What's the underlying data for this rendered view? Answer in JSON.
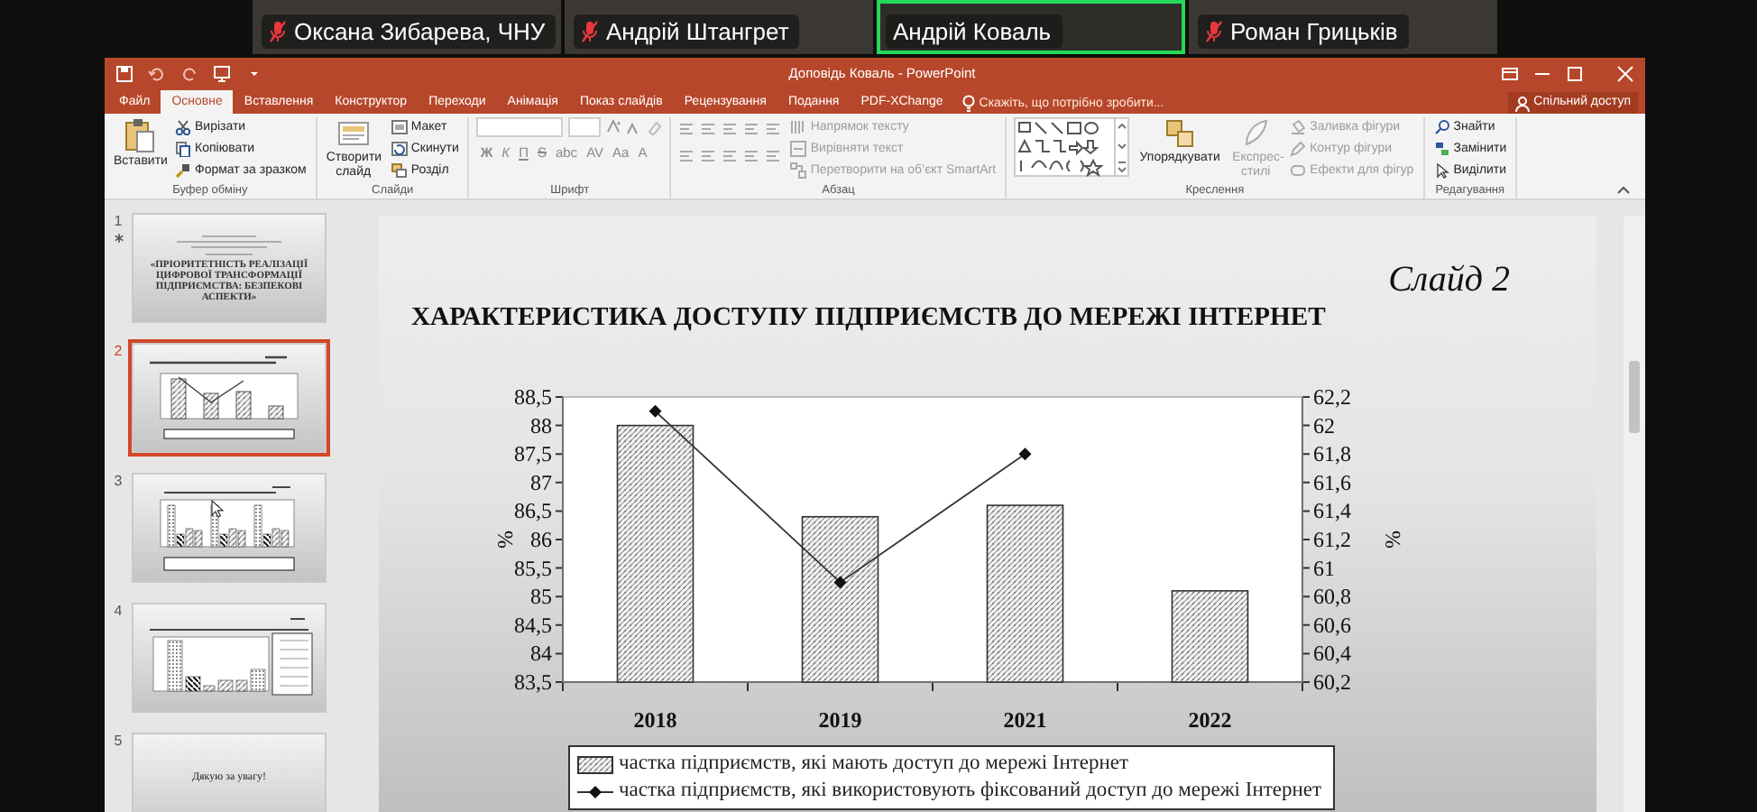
{
  "participants": [
    {
      "name": "Оксана Зибарева, ЧНУ",
      "muted": true,
      "speaking": false
    },
    {
      "name": "Андрій Штангрет",
      "muted": true,
      "speaking": false
    },
    {
      "name": "Андрій Коваль",
      "muted": false,
      "speaking": true
    },
    {
      "name": "Роман Грицьків",
      "muted": true,
      "speaking": false
    }
  ],
  "window": {
    "title": "Доповідь Коваль - PowerPoint"
  },
  "tabs": [
    {
      "label": "Файл",
      "selected": false
    },
    {
      "label": "Основне",
      "selected": true
    },
    {
      "label": "Вставлення",
      "selected": false
    },
    {
      "label": "Конструктор",
      "selected": false
    },
    {
      "label": "Переходи",
      "selected": false
    },
    {
      "label": "Анімація",
      "selected": false
    },
    {
      "label": "Показ слайдів",
      "selected": false
    },
    {
      "label": "Рецензування",
      "selected": false
    },
    {
      "label": "Подання",
      "selected": false
    },
    {
      "label": "PDF-XChange",
      "selected": false
    }
  ],
  "tell_me": {
    "placeholder": "Скажіть, що потрібно зробити..."
  },
  "share_button": "Спільний доступ",
  "ribbon": {
    "groups": [
      {
        "label": "Буфер обміну",
        "kind": "clipboard",
        "large": [
          {
            "label": "Вставити",
            "disabled": false
          }
        ],
        "small": [
          {
            "label": "Вирізати",
            "disabled": false
          },
          {
            "label": "Копіювати",
            "disabled": false
          },
          {
            "label": "Формат за зразком",
            "disabled": false
          }
        ]
      },
      {
        "label": "Слайди",
        "kind": "slides",
        "large": [
          {
            "label": "Створити слайд",
            "disabled": false
          }
        ],
        "small": [
          {
            "label": "Макет",
            "disabled": false
          },
          {
            "label": "Скинути",
            "disabled": false
          },
          {
            "label": "Розділ",
            "disabled": false
          }
        ]
      },
      {
        "label": "Шрифт",
        "kind": "font",
        "buttons": [
          "Ж",
          "К",
          "П",
          "S",
          "abc",
          "AV",
          "Aa",
          "A"
        ]
      },
      {
        "label": "Абзац",
        "kind": "paragraph",
        "small": [
          {
            "label": "Напрямок тексту",
            "disabled": true
          },
          {
            "label": "Вирівняти текст",
            "disabled": true
          },
          {
            "label": "Перетворити на об’єкт SmartArt",
            "disabled": true
          }
        ]
      },
      {
        "label": "Креслення",
        "kind": "drawing",
        "large": [
          {
            "label": "Упорядкувати",
            "disabled": false
          },
          {
            "label": "Експрес-стилі",
            "disabled": true
          }
        ],
        "small": [
          {
            "label": "Заливка фігури",
            "disabled": true
          },
          {
            "label": "Контур фігури",
            "disabled": true
          },
          {
            "label": "Ефекти для фігур",
            "disabled": true
          }
        ]
      },
      {
        "label": "Редагування",
        "kind": "editing",
        "small": [
          {
            "label": "Знайти",
            "disabled": false
          },
          {
            "label": "Замінити",
            "disabled": false
          },
          {
            "label": "Виділити",
            "disabled": false
          }
        ]
      }
    ]
  },
  "thumbnails": [
    {
      "number": "1",
      "selected": false,
      "animated": true,
      "kind": "title",
      "text": "«ПРІОРИТЕТНІСТЬ РЕАЛІЗАЦІЇ ЦИФРОВОЇ ТРАНСФОРМАЦІЇ ПІДПРИЄМСТВА: БЕЗПЕКОВІ АСПЕКТИ»"
    },
    {
      "number": "2",
      "selected": true,
      "animated": false,
      "kind": "combo"
    },
    {
      "number": "3",
      "selected": false,
      "animated": false,
      "kind": "grouped"
    },
    {
      "number": "4",
      "selected": false,
      "animated": false,
      "kind": "legend"
    },
    {
      "number": "5",
      "selected": false,
      "animated": false,
      "kind": "closing",
      "text": "Дякую за увагу!"
    }
  ],
  "slide": {
    "number_label": "Слайд 2",
    "title": "ХАРАКТЕРИСТИКА ДОСТУПУ ПІДПРИЄМСТВ ДО МЕРЕЖІ ІНТЕРНЕТ",
    "chart_data": {
      "type": "bar",
      "categories": [
        "2018",
        "2019",
        "2021",
        "2022"
      ],
      "ylabel": "%",
      "y2label": "%",
      "legend": "bottom",
      "ylim": [
        83.5,
        88.5
      ],
      "yticks": [
        {
          "value": 83.5,
          "label": "83,5"
        },
        84,
        {
          "value": 84.5,
          "label": "84,5"
        },
        85,
        {
          "value": 85.5,
          "label": "85,5"
        },
        86,
        {
          "value": 86.5,
          "label": "86,5"
        },
        87,
        {
          "value": 87.5,
          "label": "87,5"
        },
        88,
        {
          "value": 88.5,
          "label": "88,5"
        }
      ],
      "y2lim": [
        60.2,
        62.2
      ],
      "y2ticks": [
        {
          "value": 60.2,
          "label": "60,2"
        },
        {
          "value": 60.4,
          "label": "60,4"
        },
        {
          "value": 60.6,
          "label": "60,6"
        },
        {
          "value": 60.8,
          "label": "60,8"
        },
        61,
        {
          "value": 61.2,
          "label": "61,2"
        },
        {
          "value": 61.4,
          "label": "61,4"
        },
        {
          "value": 61.6,
          "label": "61,6"
        },
        {
          "value": 61.8,
          "label": "61,8"
        },
        62,
        {
          "value": 62.2,
          "label": "62,2"
        }
      ],
      "series": [
        {
          "name": "частка підприємств, які мають доступ до мережі Інтернет",
          "values": [
            88,
            86.4,
            86.6,
            85.1
          ]
        },
        {
          "name": "частка підприємств, які використовують фіксований доступ до мережі Інтернет",
          "type": "line",
          "marker": "diamond",
          "axis": "y2",
          "values": [
            62.1,
            60.9,
            61.8,
            null
          ]
        }
      ]
    }
  }
}
